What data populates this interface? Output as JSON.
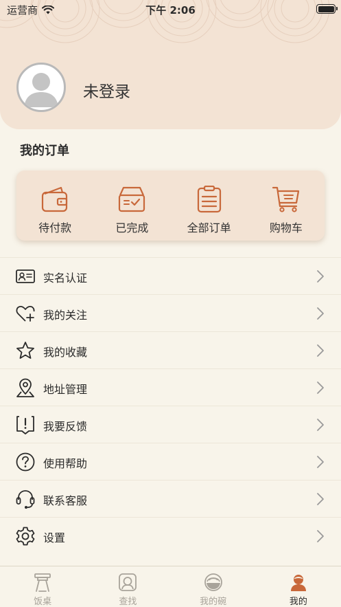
{
  "status_bar": {
    "carrier": "运营商",
    "time": "下午 2:06"
  },
  "profile": {
    "username": "未登录"
  },
  "orders": {
    "title": "我的订单",
    "items": [
      {
        "label": "待付款",
        "icon": "wallet-icon"
      },
      {
        "label": "已完成",
        "icon": "completed-box-icon"
      },
      {
        "label": "全部订单",
        "icon": "clipboard-list-icon"
      },
      {
        "label": "购物车",
        "icon": "shopping-cart-icon"
      }
    ]
  },
  "menu": [
    {
      "label": "实名认证",
      "icon": "id-card-icon"
    },
    {
      "label": "我的关注",
      "icon": "heart-plus-icon"
    },
    {
      "label": "我的收藏",
      "icon": "star-icon"
    },
    {
      "label": "地址管理",
      "icon": "location-pin-icon"
    },
    {
      "label": "我要反馈",
      "icon": "feedback-icon"
    },
    {
      "label": "使用帮助",
      "icon": "help-icon"
    },
    {
      "label": "联系客服",
      "icon": "headset-icon"
    },
    {
      "label": "设置",
      "icon": "gear-icon"
    }
  ],
  "tabbar": [
    {
      "label": "饭桌",
      "icon": "table-icon",
      "active": false
    },
    {
      "label": "查找",
      "icon": "search-icon",
      "active": false
    },
    {
      "label": "我的碗",
      "icon": "bowl-icon",
      "active": false
    },
    {
      "label": "我的",
      "icon": "profile-icon",
      "active": true
    }
  ],
  "colors": {
    "accent": "#c8683a",
    "header_bg": "#f3e3d4",
    "page_bg": "#f8f4ea"
  }
}
